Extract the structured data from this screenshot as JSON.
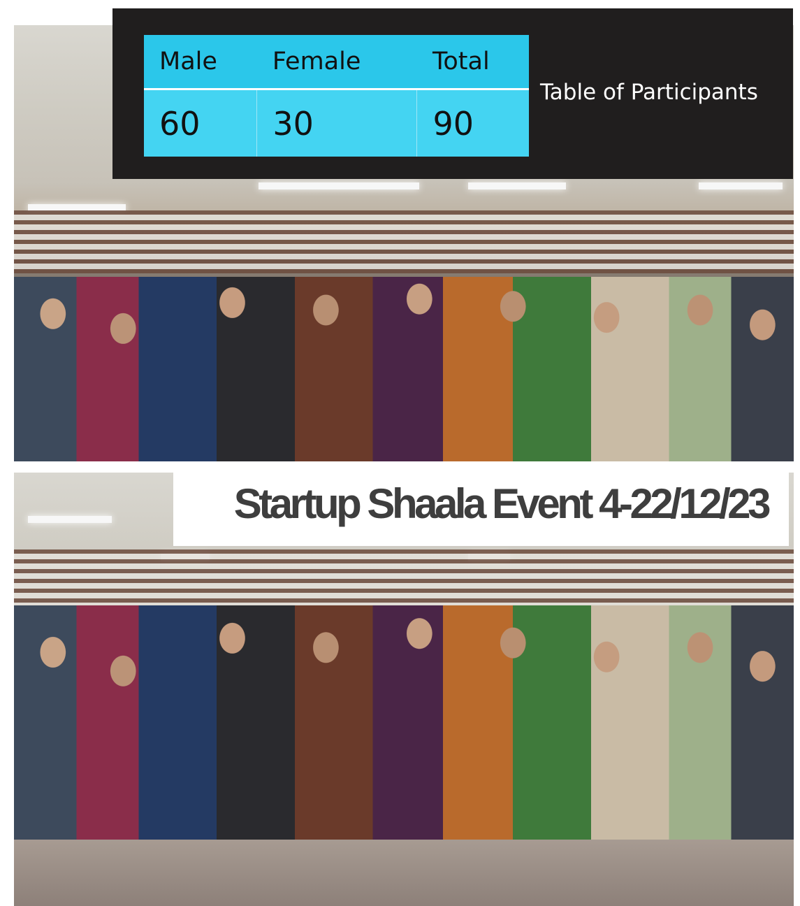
{
  "participants_table": {
    "headers": [
      "Male",
      "Female",
      "Total"
    ],
    "values": [
      "60",
      "30",
      "90"
    ],
    "caption": "Table of Participants"
  },
  "event": {
    "title": "Startup Shaala Event 4-22/12/23"
  },
  "colors": {
    "table_header": "#2bc7ea",
    "table_body": "#44d4f2",
    "overlay_background": "#201e1e",
    "title_text": "#3e3e3e"
  }
}
